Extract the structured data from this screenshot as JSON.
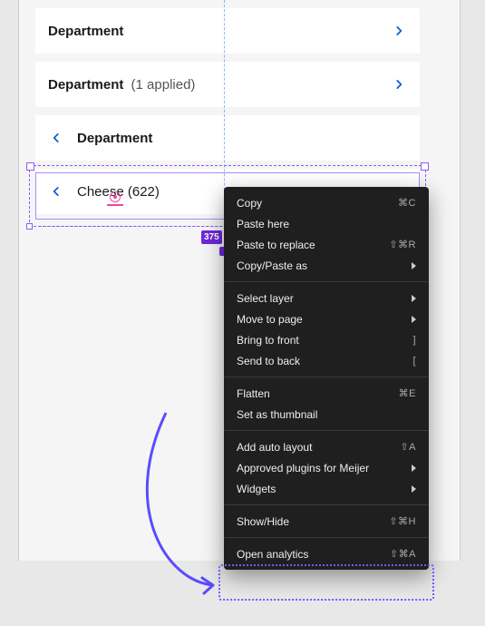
{
  "rows": {
    "dept1": {
      "label": "Department"
    },
    "dept2": {
      "label": "Department",
      "suffix": "(1 applied)"
    },
    "dept3": {
      "label": "Department"
    },
    "cheese": {
      "label": "Cheese (622)"
    }
  },
  "selection": {
    "dim": "375"
  },
  "menu": {
    "copy": {
      "label": "Copy",
      "shortcut": "⌘C"
    },
    "pasteh": {
      "label": "Paste here"
    },
    "preplace": {
      "label": "Paste to replace",
      "shortcut": "⇧⌘R"
    },
    "cpas": {
      "label": "Copy/Paste as"
    },
    "sel": {
      "label": "Select layer"
    },
    "movep": {
      "label": "Move to page"
    },
    "btf": {
      "label": "Bring to front",
      "shortcut": "]"
    },
    "stb": {
      "label": "Send to back",
      "shortcut": "["
    },
    "flat": {
      "label": "Flatten",
      "shortcut": "⌘E"
    },
    "thumb": {
      "label": "Set as thumbnail"
    },
    "aal": {
      "label": "Add auto layout",
      "shortcut": "⇧A"
    },
    "plugins": {
      "label": "Approved plugins for Meijer"
    },
    "widgets": {
      "label": "Widgets"
    },
    "showhide": {
      "label": "Show/Hide",
      "shortcut": "⇧⌘H"
    },
    "open": {
      "label": "Open analytics",
      "shortcut": "⇧⌘A"
    }
  }
}
